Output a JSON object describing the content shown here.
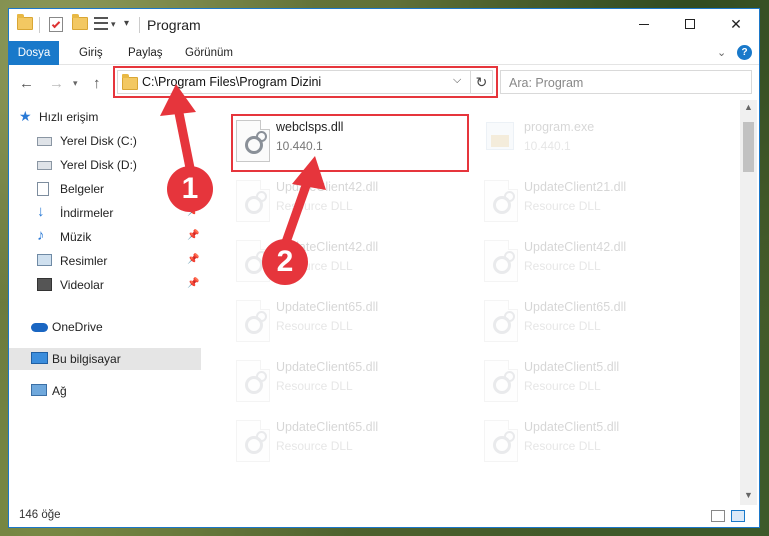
{
  "titlebar": {
    "title": "Program",
    "controls": [
      "minimize",
      "maximize",
      "close"
    ],
    "quick_access_icons": [
      "folder-icon",
      "properties-icon",
      "new-folder-icon",
      "customize-icon",
      "dropdown-icon"
    ]
  },
  "ribbon": {
    "tabs": [
      {
        "label": "Dosya"
      },
      {
        "label": "Giriş"
      },
      {
        "label": "Paylaş"
      },
      {
        "label": "Görünüm"
      }
    ]
  },
  "nav": {
    "address": "C:\\Program Files\\Program Dizini",
    "search_placeholder": "Ara: Program"
  },
  "sidebar": {
    "items": [
      {
        "label": "Hızlı erişim",
        "icon": "star-icon",
        "pinned": false
      },
      {
        "label": "Yerel Disk (C:)",
        "icon": "drive-icon",
        "pinned": true
      },
      {
        "label": "Yerel Disk (D:)",
        "icon": "drive-icon",
        "pinned": true
      },
      {
        "label": "Belgeler",
        "icon": "documents-icon",
        "pinned": true
      },
      {
        "label": "İndirmeler",
        "icon": "downloads-icon",
        "pinned": true
      },
      {
        "label": "Müzik",
        "icon": "music-icon",
        "pinned": true
      },
      {
        "label": "Resimler",
        "icon": "pictures-icon",
        "pinned": true
      },
      {
        "label": "Videolar",
        "icon": "videos-icon",
        "pinned": true
      },
      {
        "label": "OneDrive",
        "icon": "cloud-icon",
        "pinned": false
      },
      {
        "label": "Bu bilgisayar",
        "icon": "computer-icon",
        "pinned": false,
        "selected": true
      },
      {
        "label": "Ağ",
        "icon": "network-icon",
        "pinned": false
      }
    ]
  },
  "files": [
    {
      "name": "webclsps.dll",
      "sub": "10.440.1",
      "highlighted": true
    },
    {
      "name": "program.exe",
      "sub": "10.440.1",
      "faded": true
    },
    {
      "name": "UpdateClient42.dll",
      "sub": "Resource DLL",
      "faded": true
    },
    {
      "name": "UpdateClient21.dll",
      "sub": "Resource DLL",
      "faded": true
    },
    {
      "name": "UpdateClient42.dll",
      "sub": "Resource DLL",
      "faded": true
    },
    {
      "name": "UpdateClient42.dll",
      "sub": "Resource DLL",
      "faded": true
    },
    {
      "name": "UpdateClient65.dll",
      "sub": "Resource DLL",
      "faded": true
    },
    {
      "name": "UpdateClient65.dll",
      "sub": "Resource DLL",
      "faded": true
    },
    {
      "name": "UpdateClient65.dll",
      "sub": "Resource DLL",
      "faded": true
    },
    {
      "name": "UpdateClient5.dll",
      "sub": "Resource DLL",
      "faded": true
    },
    {
      "name": "UpdateClient65.dll",
      "sub": "Resource DLL",
      "faded": true
    },
    {
      "name": "UpdateClient5.dll",
      "sub": "Resource DLL",
      "faded": true
    }
  ],
  "status": {
    "count": "146 öğe"
  },
  "annotations": {
    "badge1": "1",
    "badge2": "2",
    "color": "#e6353c"
  }
}
